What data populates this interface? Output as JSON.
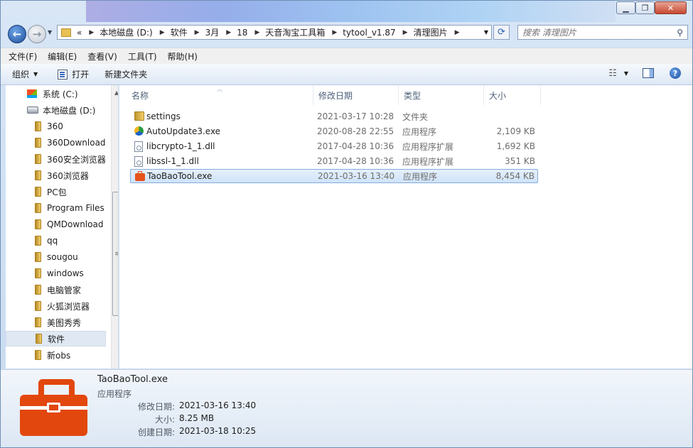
{
  "titlebar": {
    "min": "▁",
    "max": "❐",
    "close": "✕"
  },
  "nav": {
    "back": "←",
    "forward": "→"
  },
  "address": {
    "prefix": "«",
    "crumbs": [
      "本地磁盘 (D:)",
      "软件",
      "3月",
      "18",
      "天音淘宝工具箱",
      "tytool_v1.87",
      "清理图片"
    ]
  },
  "search": {
    "placeholder": "搜索 清理图片"
  },
  "menu": [
    "文件(F)",
    "编辑(E)",
    "查看(V)",
    "工具(T)",
    "帮助(H)"
  ],
  "toolbar": {
    "organize": "组织",
    "open": "打开",
    "new_folder": "新建文件夹"
  },
  "navpane": {
    "items": [
      {
        "label": "系统 (C:)",
        "icon": "system-drive-icon"
      },
      {
        "label": "本地磁盘 (D:)",
        "icon": "drive-icon"
      },
      {
        "label": "360",
        "icon": "folder-icon"
      },
      {
        "label": "360Download",
        "icon": "folder-icon"
      },
      {
        "label": "360安全浏览器",
        "icon": "folder-icon"
      },
      {
        "label": "360浏览器",
        "icon": "folder-icon"
      },
      {
        "label": "PC包",
        "icon": "folder-icon"
      },
      {
        "label": "Program Files",
        "icon": "folder-icon"
      },
      {
        "label": "QMDownload",
        "icon": "folder-icon"
      },
      {
        "label": "qq",
        "icon": "folder-icon"
      },
      {
        "label": "sougou",
        "icon": "folder-icon"
      },
      {
        "label": "windows",
        "icon": "folder-icon"
      },
      {
        "label": "电脑管家",
        "icon": "folder-icon"
      },
      {
        "label": "火狐浏览器",
        "icon": "folder-icon"
      },
      {
        "label": "美图秀秀",
        "icon": "folder-icon"
      },
      {
        "label": "软件",
        "icon": "folder-icon",
        "selected": true
      },
      {
        "label": "新obs",
        "icon": "folder-icon"
      }
    ]
  },
  "columns": {
    "name": "名称",
    "date": "修改日期",
    "type": "类型",
    "size": "大小"
  },
  "files": [
    {
      "name": "settings",
      "date": "2021-03-17 10:28",
      "type": "文件夹",
      "size": "",
      "icon": "folder-icon"
    },
    {
      "name": "AutoUpdate3.exe",
      "date": "2020-08-28 22:55",
      "type": "应用程序",
      "size": "2,109 KB",
      "icon": "update-app-icon"
    },
    {
      "name": "libcrypto-1_1.dll",
      "date": "2017-04-28 10:36",
      "type": "应用程序扩展",
      "size": "1,692 KB",
      "icon": "dll-file-icon"
    },
    {
      "name": "libssl-1_1.dll",
      "date": "2017-04-28 10:36",
      "type": "应用程序扩展",
      "size": "351 KB",
      "icon": "dll-file-icon"
    },
    {
      "name": "TaoBaoTool.exe",
      "date": "2021-03-16 13:40",
      "type": "应用程序",
      "size": "8,454 KB",
      "icon": "toolbox-icon",
      "selected": true
    }
  ],
  "details": {
    "name": "TaoBaoTool.exe",
    "type": "应用程序",
    "modified_label": "修改日期:",
    "modified": "2021-03-16 13:40",
    "size_label": "大小:",
    "size": "8.25 MB",
    "created_label": "创建日期:",
    "created": "2021-03-18 10:25"
  },
  "colors": {
    "accent": "#e2470d",
    "selection": "#cfe3f9"
  }
}
